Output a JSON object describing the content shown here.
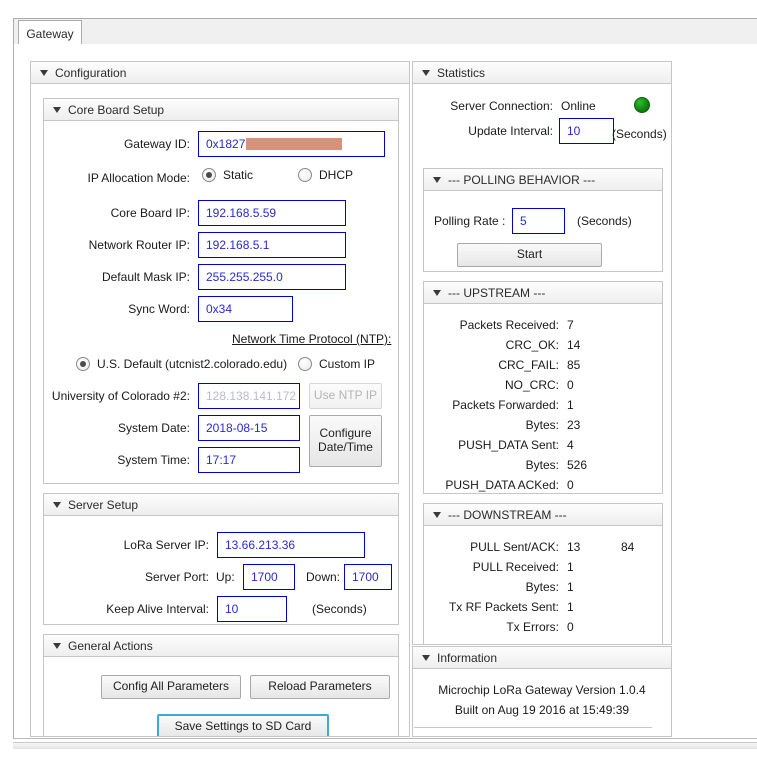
{
  "window": {
    "tab_label": "Gateway"
  },
  "configuration": {
    "title": "Configuration",
    "core_board": {
      "title": "Core Board Setup",
      "gateway_id_label": "Gateway ID:",
      "gateway_id_value": "0x1827",
      "gateway_id_redacted": true,
      "ip_alloc_label": "IP Allocation Mode:",
      "radio_static": "Static",
      "radio_dhcp": "DHCP",
      "radio_selected": "Static",
      "core_board_ip_label": "Core Board IP:",
      "core_board_ip_value": "192.168.5.59",
      "router_ip_label": "Network Router IP:",
      "router_ip_value": "192.168.5.1",
      "mask_ip_label": "Default Mask IP:",
      "mask_ip_value": "255.255.255.0",
      "sync_word_label": "Sync Word:",
      "sync_word_value": "0x34",
      "ntp_heading": "Network Time Protocol (NTP):",
      "ntp_default_label": "U.S. Default  (utcnist2.colorado.edu)",
      "ntp_custom_label": "Custom IP",
      "ntp_selected": "U.S. Default",
      "ntp_server_label": "University of Colorado #2:",
      "ntp_server_value": "128.138.141.172",
      "use_ntp_ip_button": "Use NTP IP",
      "system_date_label": "System Date:",
      "system_date_value": "2018-08-15",
      "system_time_label": "System Time:",
      "system_time_value": "17:17",
      "configure_datetime_button": "Configure\nDate/Time"
    },
    "server_setup": {
      "title": "Server Setup",
      "lora_server_ip_label": "LoRa Server IP:",
      "lora_server_ip_value": "13.66.213.36",
      "server_port_label": "Server Port:",
      "up_label": "Up:",
      "up_value": "1700",
      "down_label": "Down:",
      "down_value": "1700",
      "keep_alive_label": "Keep Alive Interval:",
      "keep_alive_value": "10",
      "keep_alive_units": "(Seconds)"
    },
    "general_actions": {
      "title": "General Actions",
      "config_all_button": "Config All Parameters",
      "reload_button": "Reload Parameters",
      "save_sd_button": "Save Settings to SD Card"
    }
  },
  "statistics": {
    "title": "Statistics",
    "server_connection_label": "Server Connection:",
    "server_connection_value": "Online",
    "server_connection_led_color": "#1f9c1f",
    "update_interval_label": "Update Interval:",
    "update_interval_value": "10",
    "update_interval_units": "(Seconds)",
    "polling": {
      "title": "--- POLLING BEHAVIOR ---",
      "polling_rate_label": "Polling Rate :",
      "polling_rate_value": "5",
      "polling_rate_units": "(Seconds)",
      "start_button": "Start"
    },
    "upstream": {
      "title": "--- UPSTREAM ---",
      "rows": [
        {
          "label": "Packets Received:",
          "value": "7"
        },
        {
          "label": "CRC_OK:",
          "value": "14"
        },
        {
          "label": "CRC_FAIL:",
          "value": "85"
        },
        {
          "label": "NO_CRC:",
          "value": "0"
        },
        {
          "label": "Packets Forwarded:",
          "value": "1"
        },
        {
          "label": "Bytes:",
          "value": "23"
        },
        {
          "label": "PUSH_DATA Sent:",
          "value": "4"
        },
        {
          "label": "Bytes:",
          "value": "526"
        },
        {
          "label": "PUSH_DATA ACKed:",
          "value": "0"
        }
      ]
    },
    "downstream": {
      "title": "--- DOWNSTREAM ---",
      "rows": [
        {
          "label": "PULL Sent/ACK:",
          "value": "13",
          "value2": "84"
        },
        {
          "label": "PULL Received:",
          "value": "1",
          "value2": ""
        },
        {
          "label": "Bytes:",
          "value": "1",
          "value2": ""
        },
        {
          "label": "Tx RF Packets Sent:",
          "value": "1",
          "value2": ""
        },
        {
          "label": "Tx Errors:",
          "value": "0",
          "value2": ""
        }
      ]
    }
  },
  "information": {
    "title": "Information",
    "line1": "Microchip LoRa Gateway Version 1.0.4",
    "line2": "Built on Aug 19 2016 at 15:49:39"
  }
}
